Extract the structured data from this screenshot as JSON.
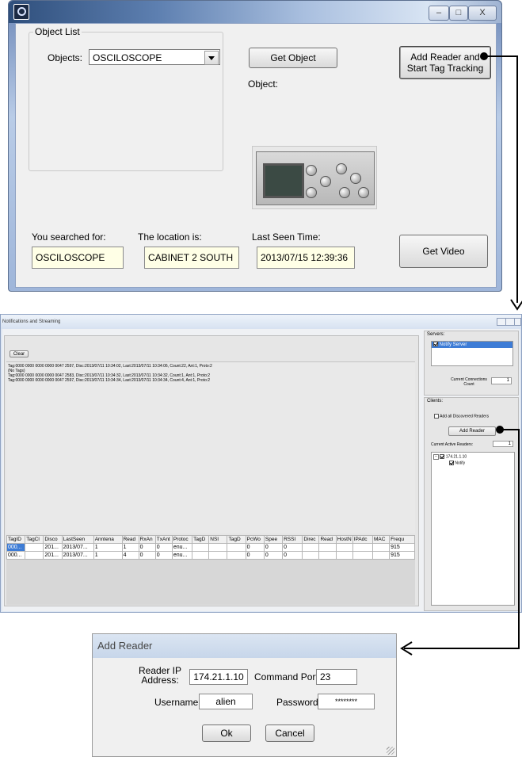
{
  "win1": {
    "group_label": "Object List",
    "objects_label": "Objects:",
    "objects_value": "OSCILOSCOPE",
    "get_object": "Get Object",
    "object_label": "Object:",
    "add_reader_btn": "Add Reader and Start Tag Tracking",
    "searched_label": "You searched for:",
    "searched_value": "OSCILOSCOPE",
    "location_label": "The location is:",
    "location_value": "CABINET 2 SOUTH",
    "lastseen_label": "Last Seen Time:",
    "lastseen_value": "2013/07/15 12:39:36",
    "get_video": "Get Video",
    "min_icon": "minimize-icon",
    "max_icon": "maximize-icon",
    "close_glyph": "X"
  },
  "win2": {
    "title": "Notifications and Streaming",
    "clear": "Clear",
    "log": [
      "Tag:0000 0000 0000 0000 0047 2597, Disc:2013/07/11 10:34:02, Last:2013/07/11 10:34:06, Count:22, Ant:1, Proto:2",
      "(No Tags)",
      "Tag:0000 0000 0000 0000 0047 2583, Disc:2013/07/11 10:34:32, Last:2013/07/11 10:34:32, Count:1, Ant:1, Proto:2",
      "Tag:0000 0000 0000 0000 0047 2597, Disc:2013/07/11 10:34:34, Last:2013/07/11 10:34:34, Count:4, Ant:1, Proto:2"
    ],
    "columns": [
      "TagID",
      "TagCl",
      "Disco",
      "LastSeen",
      "Anntena",
      "Read",
      "RxAn",
      "TxAnt",
      "Protoc",
      "TagD",
      "NSI",
      "TagD",
      "PcWo",
      "Spee",
      "RSSI",
      "Direc",
      "Read",
      "HostN",
      "IPAdc",
      "MAC",
      "Frequ"
    ],
    "rows": [
      [
        "000...",
        "",
        "201...",
        "2013/07...",
        "1",
        "1",
        "0",
        "0",
        "enu...",
        "",
        "",
        "",
        "0",
        "0",
        "0",
        "",
        "",
        "",
        "",
        "",
        "915"
      ],
      [
        "000...",
        "",
        "201...",
        "2013/07...",
        "1",
        "4",
        "0",
        "0",
        "enu...",
        "",
        "",
        "",
        "0",
        "0",
        "0",
        "",
        "",
        "",
        "",
        "",
        "915"
      ]
    ],
    "servers_label": "Servers:",
    "server_item": "Notify Server",
    "connections_label": "Current Connections Count",
    "connections_value": "1",
    "clients_label": "Clients:",
    "add_all": "Add all Discovered Readers",
    "add_reader": "Add Reader",
    "active_readers_label": "Current Active Readers:",
    "active_readers_value": "1",
    "tree_ip": "174.21.1.10",
    "tree_notify": "Notify"
  },
  "win3": {
    "title": "Add Reader",
    "ip_label": "Reader IP Address:",
    "ip_value": "174.21.1.10",
    "port_label": "Command Port:",
    "port_value": "23",
    "user_label": "Username:",
    "user_value": "alien",
    "pass_label": "Password:",
    "pass_value": "********",
    "ok": "Ok",
    "cancel": "Cancel"
  },
  "colors": {
    "yellow_field": "#ffffe6",
    "selection": "#3d7cd6",
    "connector": "#000000"
  }
}
